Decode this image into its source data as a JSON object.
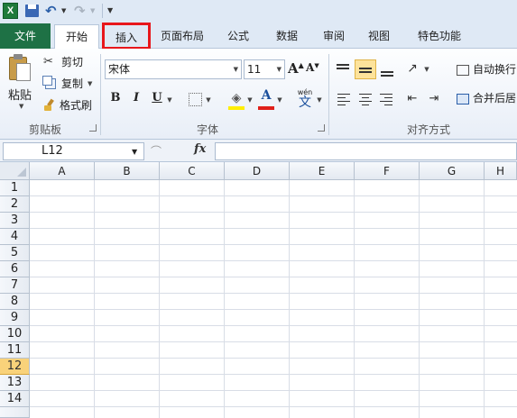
{
  "app": {
    "logo_letter": "X"
  },
  "tabs": {
    "file": "文件",
    "home": "开始",
    "insert": "插入",
    "page_layout": "页面布局",
    "formulas": "公式",
    "data": "数据",
    "review": "审阅",
    "view": "视图",
    "special": "特色功能"
  },
  "highlight_color": "#e8161b",
  "file_tab_color": "#1e7145",
  "clipboard": {
    "paste": "粘贴",
    "cut": "剪切",
    "copy": "复制",
    "format_painter": "格式刷",
    "group_label": "剪贴板"
  },
  "font": {
    "name": "宋体",
    "size": "11",
    "bold": "B",
    "italic": "I",
    "underline": "U",
    "grow": "A",
    "shrink": "A",
    "color_letter": "A",
    "phonetic": "wén",
    "phonetic_char": "文",
    "group_label": "字体"
  },
  "alignment": {
    "wrap_text": "自动换行",
    "merge_center": "合并后居",
    "group_label": "对齐方式"
  },
  "formula_bar": {
    "name_box": "L12",
    "fx": "fx",
    "value": ""
  },
  "grid": {
    "columns": [
      "A",
      "B",
      "C",
      "D",
      "E",
      "F",
      "G",
      "H"
    ],
    "rows": [
      "1",
      "2",
      "3",
      "4",
      "5",
      "6",
      "7",
      "8",
      "9",
      "10",
      "11",
      "12",
      "13",
      "14"
    ],
    "active_row": "12",
    "active_color": "#f9d27a"
  }
}
